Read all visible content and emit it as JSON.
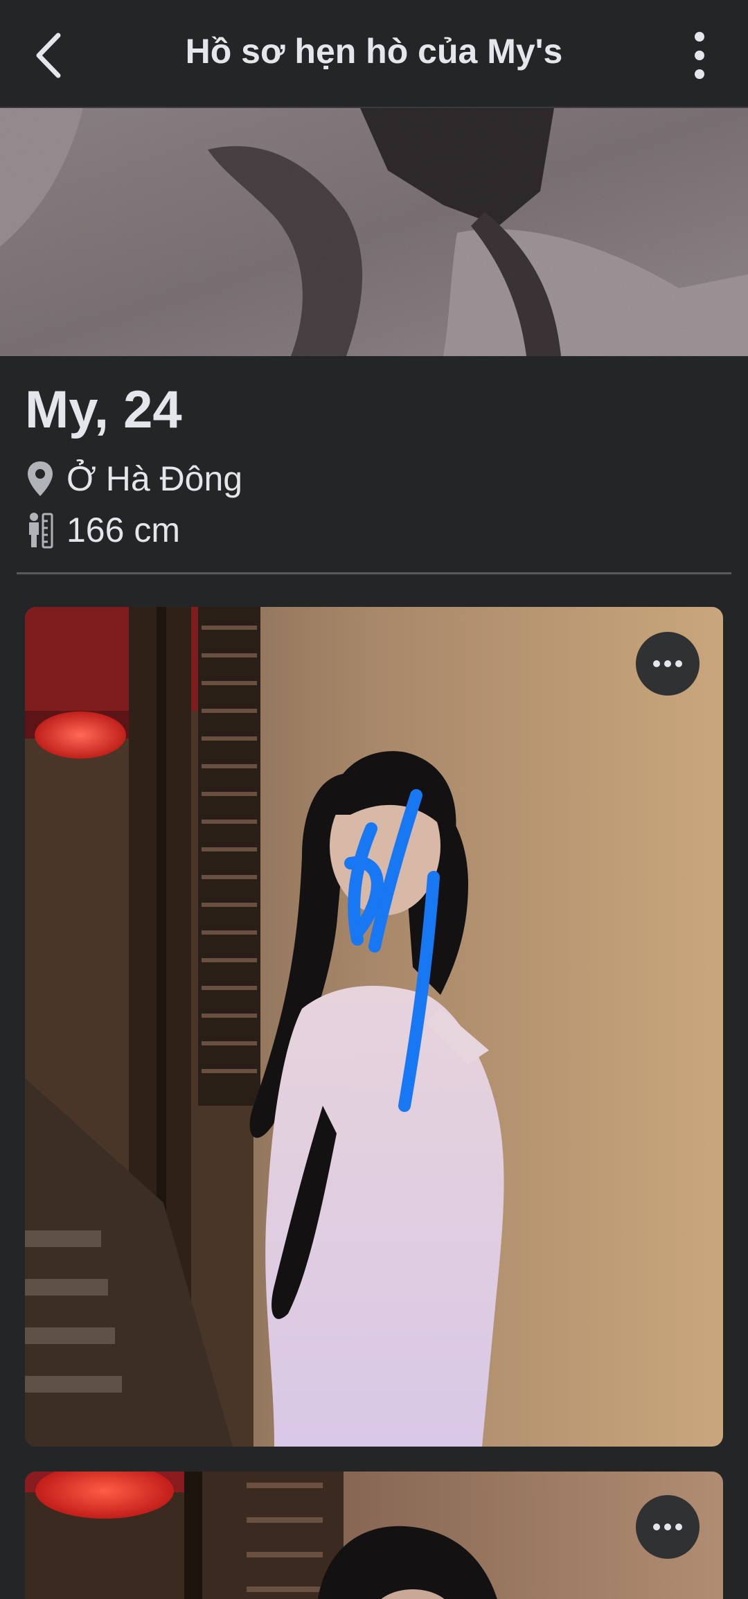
{
  "header": {
    "title": "Hồ sơ hẹn hò của My's",
    "back_icon": "chevron-left-icon",
    "menu_icon": "more-vertical-icon"
  },
  "profile": {
    "name_age": "My, 24",
    "location": "Ở Hà Đông",
    "location_icon": "location-pin-icon",
    "height": "166 cm",
    "height_icon": "height-ruler-icon"
  },
  "photos": [
    {
      "menu_icon": "more-horizontal-icon"
    },
    {
      "menu_icon": "more-horizontal-icon"
    }
  ],
  "colors": {
    "background": "#242527",
    "text": "#e4e6eb",
    "divider": "#5a5b5e",
    "button_bg": "#303133"
  }
}
